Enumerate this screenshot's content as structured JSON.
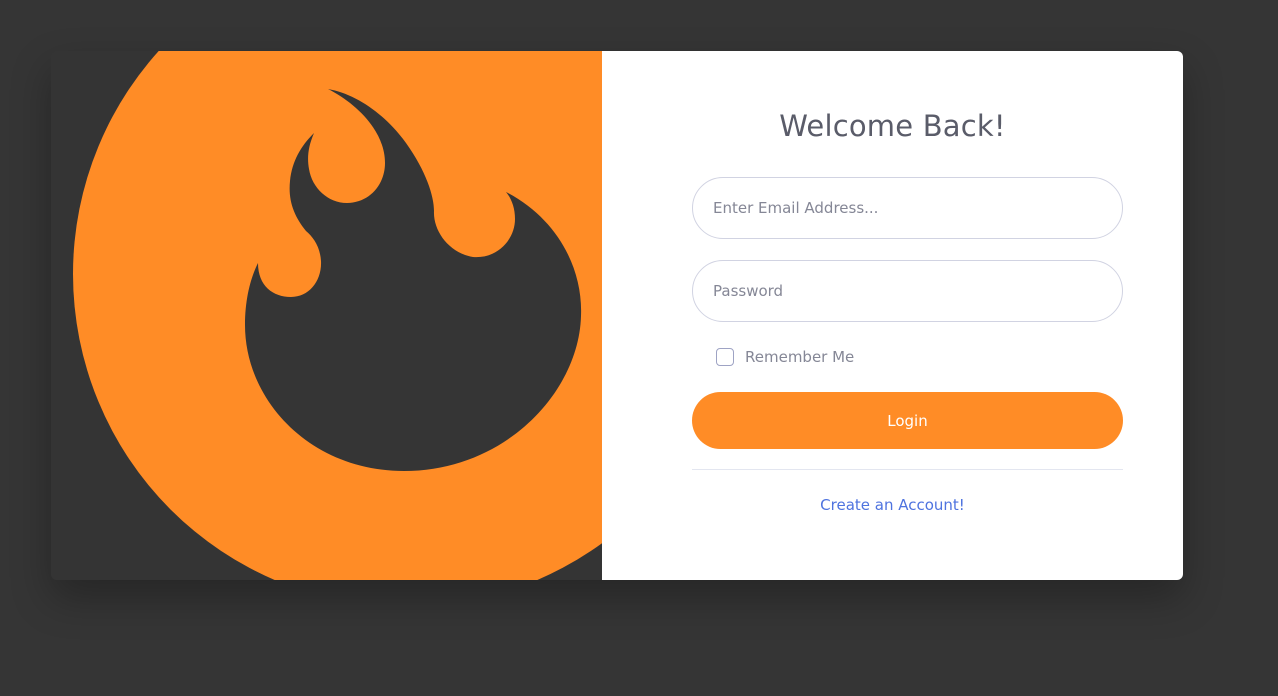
{
  "brand": {
    "logo_icon": "flame-icon",
    "accent_color": "#ff8c26",
    "panel_color": "#343434"
  },
  "login": {
    "title": "Welcome Back!",
    "email_placeholder": "Enter Email Address...",
    "password_placeholder": "Password",
    "remember_label": "Remember Me",
    "remember_checked": false,
    "login_label": "Login",
    "create_account_label": "Create an Account!"
  }
}
